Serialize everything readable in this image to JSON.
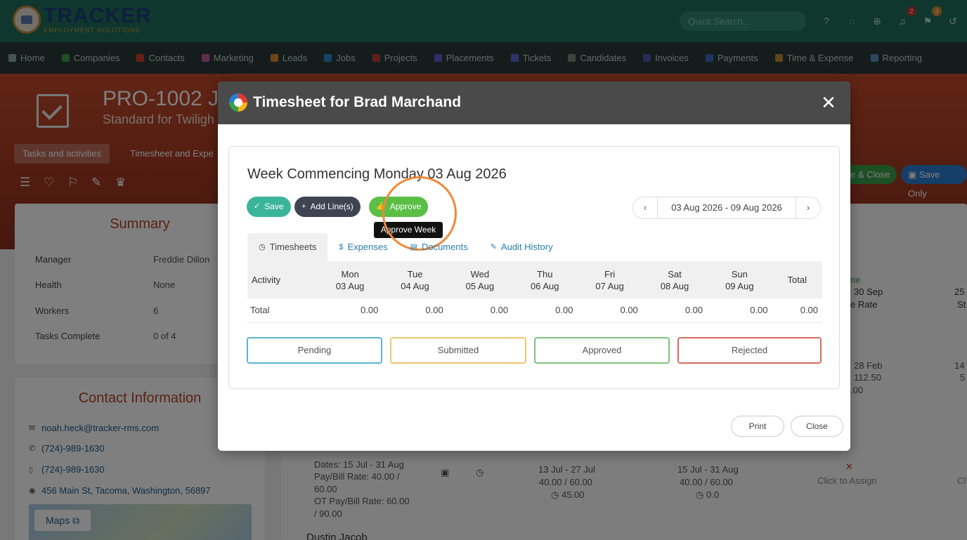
{
  "header": {
    "logo_text": "TRACKER",
    "logo_subtext": "EMPLOYMENT SOLUTIONS",
    "search_placeholder": "Quick Search...",
    "notifications_badge": "2",
    "flags_badge": "3"
  },
  "nav": [
    {
      "label": "Home",
      "color": "#8aa"
    },
    {
      "label": "Companies",
      "color": "#3a9a4a"
    },
    {
      "label": "Contacts",
      "color": "#d0402a"
    },
    {
      "label": "Marketing",
      "color": "#c05aa0"
    },
    {
      "label": "Leads",
      "color": "#e08a2a"
    },
    {
      "label": "Jobs",
      "color": "#2a8ad0"
    },
    {
      "label": "Projects",
      "color": "#c03a3a"
    },
    {
      "label": "Placements",
      "color": "#5a5ad0"
    },
    {
      "label": "Tickets",
      "color": "#5a6ad0"
    },
    {
      "label": "Candidates",
      "color": "#7a8a7a"
    },
    {
      "label": "Invoices",
      "color": "#4a5ab0"
    },
    {
      "label": "Payments",
      "color": "#3a6ac0"
    },
    {
      "label": "Time & Expense",
      "color": "#c08a3a"
    },
    {
      "label": "Reporting",
      "color": "#5a8ac0"
    }
  ],
  "background": {
    "project_title": "PRO-1002 J",
    "project_subtitle": "Standard for Twiligh",
    "tab_tasks": "Tasks and activities",
    "tab_timesheet": "Timesheet and Expe",
    "save_close": "e & Close",
    "save_only": "Save Only",
    "summary_title": "Summary",
    "summary": [
      {
        "label": "Manager",
        "value": "Freddie Dillon"
      },
      {
        "label": "Health",
        "value": "None"
      },
      {
        "label": "Workers",
        "value": "6"
      },
      {
        "label": "Tasks Complete",
        "value": "0 of 4"
      }
    ],
    "contact_title": "Contact Information",
    "email": "noah.heck@tracker-rms.com",
    "phone1": "(724)-989-1630",
    "phone2": "(724)-989-1630",
    "address": "456 Main St, Tacoma, Washington, 56897",
    "maps_label": "Maps",
    "dates_text": "Dates: 15 Jul - 31 Aug",
    "paybill_text": "Pay/Bill Rate: 40.00 /",
    "paybill_text2": "60.00",
    "ot_text": "OT Pay/Bill Rate: 60.00",
    "ot_text2": "/ 90.00",
    "col1_date": "13 Jul - 27 Jul",
    "col1_rate": "40.00 / 60.00",
    "col1_hours": "45.00",
    "col2_date": "15 Jul - 31 Aug",
    "col2_rate": "40.00 / 60.00",
    "col2_hours": "0.0",
    "click_assign": "Click to Assign",
    "next_name": "Dustin Jacob",
    "right_time": "time",
    "right_date": "30 Sep",
    "right_rate": "e Rate",
    "right_25": "25",
    "right_st": "St",
    "right_28feb": "28 Feb",
    "right_11250": "112.50",
    "right_00": ".00",
    "right_14": "14",
    "right_5": "5",
    "right_cl": "Cl"
  },
  "modal": {
    "title": "Timesheet for Brad Marchand",
    "week_title": "Week Commencing Monday 03 Aug 2026",
    "buttons": {
      "save": "Save",
      "add_lines": "Add Line(s)",
      "approve": "Approve",
      "approve_tooltip": "Approve Week"
    },
    "date_range": "03 Aug 2026 - 09 Aug 2026",
    "tabs": {
      "timesheets": "Timesheets",
      "expenses": "Expenses",
      "documents": "Documents",
      "audit_history": "Audit History"
    },
    "table": {
      "activity_header": "Activity",
      "total_header": "Total",
      "days": [
        {
          "day": "Mon",
          "date": "03 Aug"
        },
        {
          "day": "Tue",
          "date": "04 Aug"
        },
        {
          "day": "Wed",
          "date": "05 Aug"
        },
        {
          "day": "Thu",
          "date": "06 Aug"
        },
        {
          "day": "Fri",
          "date": "07 Aug"
        },
        {
          "day": "Sat",
          "date": "08 Aug"
        },
        {
          "day": "Sun",
          "date": "09 Aug"
        }
      ],
      "total_row": {
        "label": "Total",
        "values": [
          "0.00",
          "0.00",
          "0.00",
          "0.00",
          "0.00",
          "0.00",
          "0.00"
        ],
        "total": "0.00"
      }
    },
    "status": {
      "pending": "Pending",
      "submitted": "Submitted",
      "approved": "Approved",
      "rejected": "Rejected"
    },
    "footer": {
      "print": "Print",
      "close": "Close"
    }
  }
}
